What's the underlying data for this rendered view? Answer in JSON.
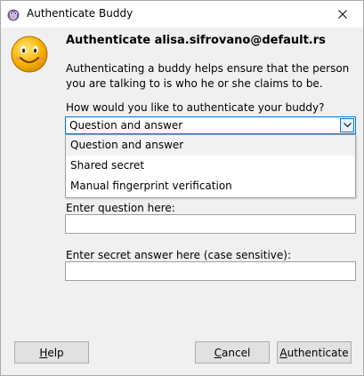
{
  "window": {
    "title": "Authenticate Buddy"
  },
  "icons": {
    "app": "pidgin-app-icon",
    "close": "close-icon",
    "avatar": "smiley-face-icon",
    "combo_arrow": "chevron-down-icon"
  },
  "colors": {
    "accent": "#0078d7",
    "dialog_bg": "#f0f0f0",
    "selected_item_bg": "#f2f2f2"
  },
  "header": {
    "heading": "Authenticate alisa.sifrovano@default.rs",
    "description": "Authenticating a buddy helps ensure that the person you are talking to is who he or she claims to be."
  },
  "method": {
    "label": "How would you like to authenticate your buddy?",
    "selected": "Question and answer",
    "options": [
      "Question and answer",
      "Shared secret",
      "Manual fingerprint verification"
    ]
  },
  "question_field": {
    "label": "Enter question here:",
    "value": ""
  },
  "answer_field": {
    "label": "Enter secret answer here (case sensitive):",
    "value": ""
  },
  "buttons": {
    "help_mnemonic": "H",
    "help_rest": "elp",
    "cancel_mnemonic": "C",
    "cancel_rest": "ancel",
    "auth_mnemonic": "A",
    "auth_rest": "uthenticate"
  }
}
